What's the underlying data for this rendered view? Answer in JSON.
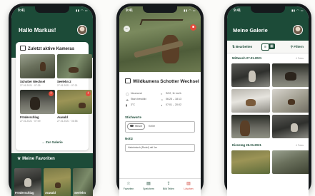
{
  "status_time": "9:41",
  "phone1": {
    "greeting": "Hallo Markus!",
    "recent_title": "Zuletzt aktive Kameras",
    "cameras": [
      {
        "name": "Schotter Wechsel",
        "date": "27.01.2021 · 07:25"
      },
      {
        "name": "Seelehn 2",
        "date": "27.01.2021 · 07:21"
      },
      {
        "name": "Fröderschlag",
        "date": "27.01.2021 · 07:09"
      },
      {
        "name": "Auwald",
        "date": "27.01.2021 · 06:58"
      }
    ],
    "gallery_link": "Zur Galerie",
    "favorites_title": "Meine Favoriten",
    "favorites": [
      {
        "name": "Fröderschlag"
      },
      {
        "name": "Auwald"
      },
      {
        "name": "Seelehn"
      }
    ]
  },
  "phone2": {
    "title": "Wildkamera Schotter Wechsel",
    "details_left": [
      "Neumond",
      "Stark bewölkt",
      "3°C"
    ],
    "details_right": [
      "SO2, 11 km/h",
      "06:25 – 18:13",
      "07:01 – 20:02"
    ],
    "keywords_title": "Stichworte",
    "keyword_chip": "Hirsch",
    "keyword_extra": "Keiler",
    "notes_title": "Notiz",
    "note_text": "Habelmisch (Rudel) mit 1er",
    "nav": [
      "Favoriten",
      "Speichern",
      "Bild Teilen",
      "Löschen"
    ]
  },
  "phone3": {
    "title": "Meine Galerie",
    "edit_label": "Bearbeiten",
    "filter_label": "Filtern",
    "days": [
      {
        "date": "Mittwoch 27.01.2021",
        "count": "4 Fotos"
      },
      {
        "date": "Dienstag 26.01.2021",
        "count": "4 Fotos"
      }
    ]
  },
  "colors": {
    "primary": "#1c4b38",
    "danger": "#e14b3b"
  }
}
